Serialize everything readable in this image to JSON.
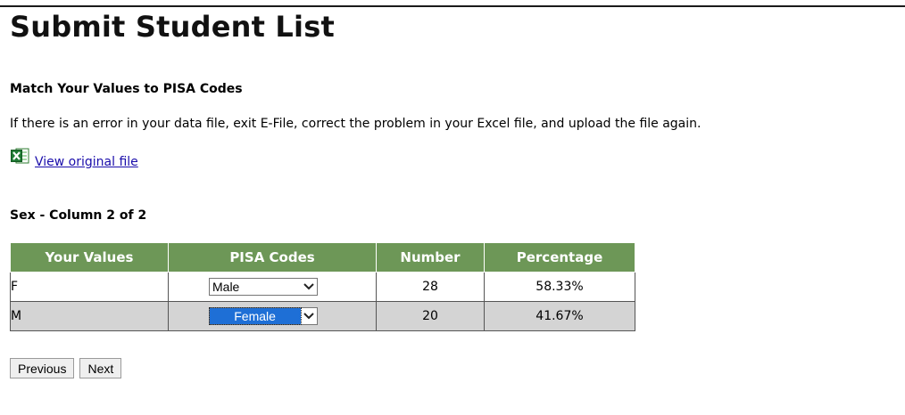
{
  "page": {
    "title": "Submit Student List"
  },
  "section": {
    "heading": "Match Your Values to PISA Codes",
    "instructions": "If there is an error in your data file, exit E-File, correct the problem in your Excel file, and upload the file again."
  },
  "file_link": {
    "label": "View original file",
    "icon": "excel-icon"
  },
  "column": {
    "heading": "Sex - Column 2 of 2"
  },
  "table": {
    "headers": [
      "Your Values",
      "PISA Codes",
      "Number",
      "Percentage"
    ],
    "rows": [
      {
        "value": "F",
        "code": "Male",
        "number": "28",
        "percentage": "58.33%"
      },
      {
        "value": "M",
        "code": "Female",
        "number": "20",
        "percentage": "41.67%"
      }
    ],
    "header_color": "#6d9757",
    "alt_row_color": "#d4d4d4"
  },
  "buttons": {
    "previous": "Previous",
    "next": "Next"
  }
}
